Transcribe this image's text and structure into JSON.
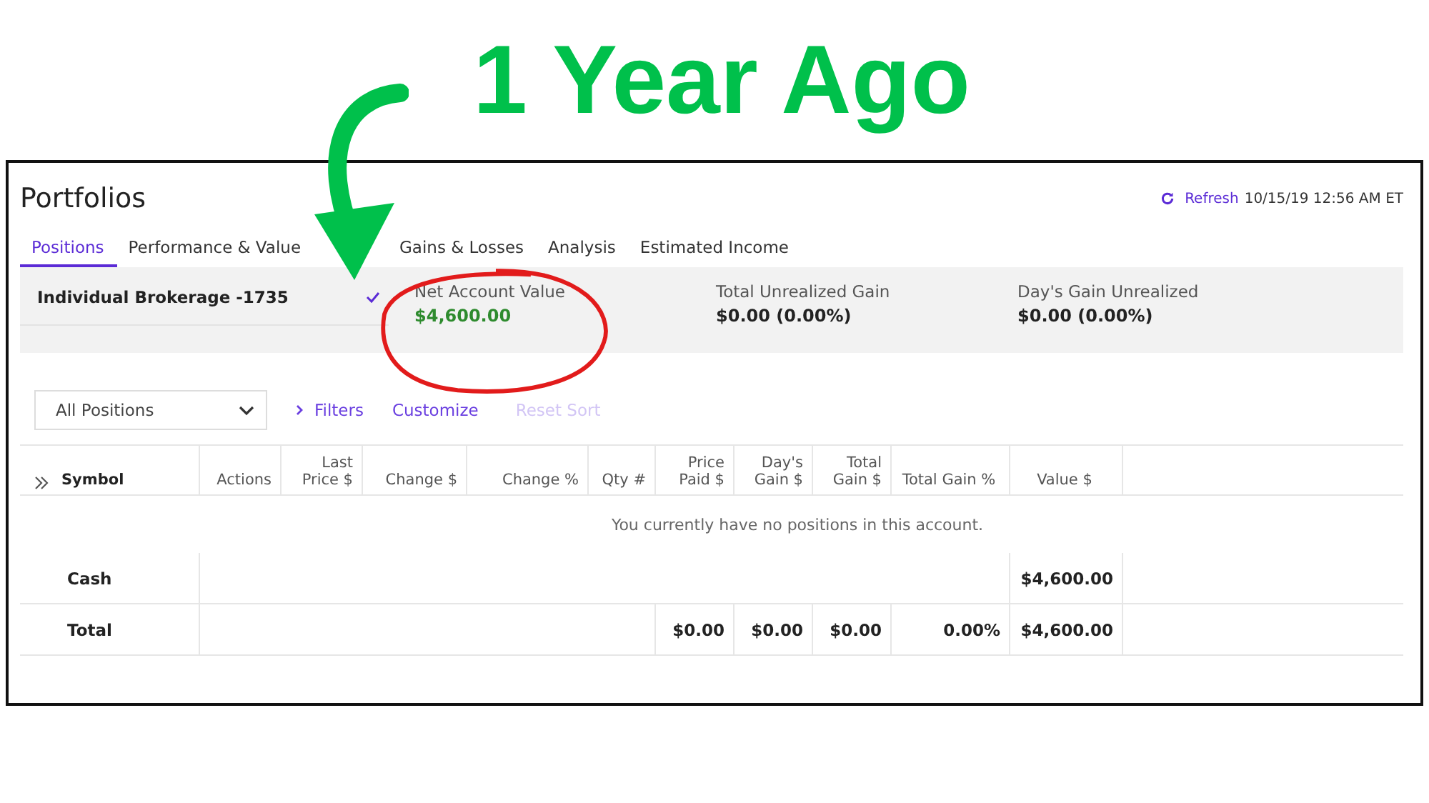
{
  "annotation": {
    "headline": "1 Year Ago"
  },
  "page": {
    "title": "Portfolios",
    "refresh": {
      "label": "Refresh",
      "timestamp": "10/15/19 12:56 AM ET"
    }
  },
  "tabs": [
    {
      "label": "Positions",
      "selected": true
    },
    {
      "label": "Performance & Value",
      "selected": false
    },
    {
      "label": "Gains & Losses",
      "selected": false
    },
    {
      "label": "Analysis",
      "selected": false
    },
    {
      "label": "Estimated Income",
      "selected": false
    }
  ],
  "account": {
    "name": "Individual Brokerage -1735"
  },
  "metrics": [
    {
      "label": "Net Account Value",
      "value": "$4,600.00",
      "kind": "positive"
    },
    {
      "label": "Total Unrealized Gain",
      "value": "$0.00  (0.00%)",
      "kind": "neutral"
    },
    {
      "label": "Day's Gain Unrealized",
      "value": "$0.00  (0.00%)",
      "kind": "neutral"
    }
  ],
  "toolbar": {
    "view_select": "All Positions",
    "links": [
      {
        "label": "Filters",
        "disabled": false,
        "kind": "expander"
      },
      {
        "label": "Customize",
        "disabled": false,
        "kind": "plain"
      },
      {
        "label": "Reset Sort",
        "disabled": true,
        "kind": "plain"
      }
    ]
  },
  "table": {
    "columns": [
      "Symbol",
      "Actions",
      "Last\nPrice $",
      "Change $",
      "Change %",
      "Qty #",
      "Price\nPaid $",
      "Day's\nGain $",
      "Total\nGain $",
      "Total Gain %",
      "Value $"
    ],
    "empty_message": "You currently have no positions in this account.",
    "rows": [
      {
        "cells": [
          "Cash",
          null,
          null,
          null,
          null,
          null,
          null,
          null,
          null,
          null,
          "$4,600.00"
        ]
      },
      {
        "cells": [
          "Total",
          null,
          null,
          null,
          null,
          null,
          "$0.00",
          "$0.00",
          "$0.00",
          "0.00%",
          "$4,600.00"
        ]
      }
    ]
  }
}
